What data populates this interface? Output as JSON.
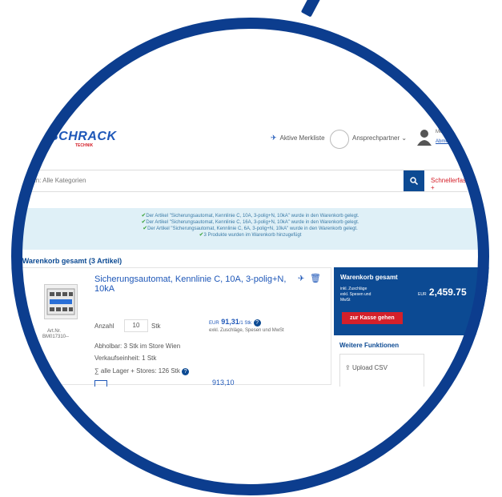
{
  "header": {
    "logo_text": "SCHRACK",
    "logo_sub": "TECHNIK",
    "wishlist_label": "Aktive Merkliste",
    "contact_label": "Ansprechpartner",
    "account_title": "Mein Konto",
    "account_logout": "Abmelden"
  },
  "search": {
    "placeholder": "Suche in: Alle Kategorien",
    "quick_entry": "Schnellerfassung +"
  },
  "notifications": [
    "Der Artikel \"Sicherungsautomat, Kennlinie C, 10A, 3-polig+N, 10kA\" wurde in den Warenkorb gelegt.",
    "Der Artikel \"Sicherungsautomat, Kennlinie C, 16A, 3-polig+N, 10kA\" wurde in den Warenkorb gelegt.",
    "Der Artikel \"Sicherungsautomat, Kennlinie C, 6A, 3-polig+N, 10kA\" wurde in den Warenkorb gelegt.",
    "3 Produkte wurden im Warenkorb hinzugefügt"
  ],
  "cart": {
    "title": "Warenkorb gesamt (3 Artikel)",
    "item": {
      "name_line1": "Sicherungsautomat, Kennlinie C, 10A, 3-polig+N,",
      "name_line2": "10kA",
      "article_label": "Art.Nr.",
      "article_no": "BM017310--",
      "quantity_label": "Anzahl",
      "quantity_value": "10",
      "unit": "Stk",
      "price_prefix": "EUR",
      "price": "91,31",
      "price_per": "/1 Stk",
      "price_note": "exkl. Zuschläge, Spesen und MwSt",
      "pickup": "Abholbar: 3 Stk im Store Wien",
      "sales_unit": "Verkaufseinheit: 1 Stk",
      "stock": "∑ alle Lager + Stores: 126 Stk",
      "next_price": "913,10"
    }
  },
  "summary": {
    "title": "Warenkorb gesamt",
    "incl_line1": "inkl. Zuschläge",
    "incl_line2": "exkl. Spesen und",
    "incl_line3": "MwSt",
    "currency": "EUR",
    "total": "2,459.75",
    "checkout_label": "zur Kasse gehen"
  },
  "functions": {
    "title": "Weitere Funktionen",
    "upload_csv": "Upload CSV"
  },
  "colors": {
    "brand_blue": "#0c4a93",
    "ring_blue": "#0c3d8e",
    "accent_red": "#d4202a",
    "notif_bg": "#dff0f7"
  }
}
